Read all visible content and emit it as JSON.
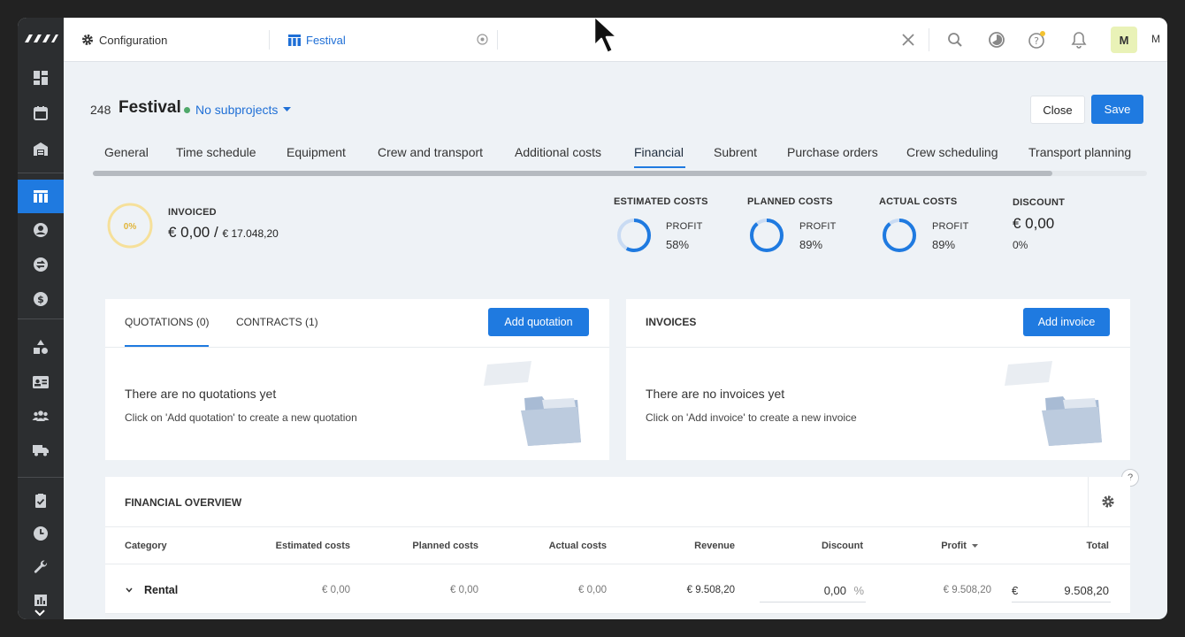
{
  "topbar": {
    "tabs": [
      {
        "label": "Configuration",
        "icon": "gear-icon"
      },
      {
        "label": "Festival",
        "icon": "table-icon"
      }
    ],
    "avatar": {
      "initial": "M",
      "name": "M"
    }
  },
  "header": {
    "project_number": "248",
    "project_name": "Festival",
    "subprojects_label": "No subprojects",
    "close_label": "Close",
    "save_label": "Save"
  },
  "nav_tabs": [
    "General",
    "Time schedule",
    "Equipment",
    "Crew and transport",
    "Additional costs",
    "Financial",
    "Subrent",
    "Purchase orders",
    "Crew scheduling",
    "Transport planning"
  ],
  "active_tab": "Financial",
  "summary": {
    "invoiced_label": "INVOICED",
    "invoiced_percent": "0%",
    "invoiced_amount": "€ 0,00 /",
    "invoiced_total": "€ 17.048,20",
    "estimated_costs_label": "ESTIMATED COSTS",
    "estimated_profit_label": "PROFIT",
    "estimated_profit_value": "58%",
    "estimated_profit_fraction": 0.58,
    "planned_costs_label": "PLANNED COSTS",
    "planned_profit_label": "PROFIT",
    "planned_profit_value": "89%",
    "planned_profit_fraction": 0.89,
    "actual_costs_label": "ACTUAL COSTS",
    "actual_profit_label": "PROFIT",
    "actual_profit_value": "89%",
    "actual_profit_fraction": 0.89,
    "discount_label": "DISCOUNT",
    "discount_amount": "€ 0,00",
    "discount_percent": "0%"
  },
  "quotations_panel": {
    "tab_quotations": "QUOTATIONS (0)",
    "tab_contracts": "CONTRACTS (1)",
    "add_label": "Add quotation",
    "empty_title": "There are no quotations yet",
    "empty_sub": "Click on 'Add quotation' to create a new quotation"
  },
  "invoices_panel": {
    "title": "INVOICES",
    "add_label": "Add invoice",
    "empty_title": "There are no invoices yet",
    "empty_sub": "Click on 'Add invoice' to create a new invoice"
  },
  "financial_overview": {
    "title": "FINANCIAL OVERVIEW",
    "columns": [
      "Category",
      "Estimated costs",
      "Planned costs",
      "Actual costs",
      "Revenue",
      "Discount",
      "Profit",
      "Total"
    ],
    "rows": [
      {
        "category": "Rental",
        "estimated": "€ 0,00",
        "planned": "€ 0,00",
        "actual": "€ 0,00",
        "revenue": "€ 9.508,20",
        "discount": "0,00",
        "discount_unit": "%",
        "profit": "€ 9.508,20",
        "total_currency": "€",
        "total": "9.508,20"
      }
    ]
  },
  "colors": {
    "accent": "#1f7ae0",
    "sidebar": "#2c2e30",
    "invoiced_ring": "#f3d77a"
  }
}
